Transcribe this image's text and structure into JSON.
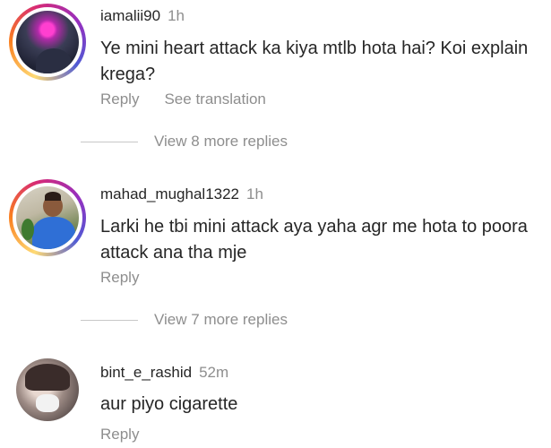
{
  "comments": [
    {
      "username": "iamalii90",
      "time": "1h",
      "text": "Ye mini heart attack ka kiya mtlb hota hai? Koi explain krega?",
      "reply_label": "Reply",
      "translation_label": "See translation",
      "view_replies": "View 8 more replies"
    },
    {
      "username": "mahad_mughal1322",
      "time": "1h",
      "text": "Larki he tbi mini attack aya yaha agr me hota to poora attack ana tha mje",
      "reply_label": "Reply",
      "view_replies": "View 7 more replies"
    },
    {
      "username": "bint_e_rashid",
      "time": "52m",
      "text": "aur piyo cigarette",
      "reply_label": "Reply"
    }
  ],
  "colors": {
    "text": "#262626",
    "muted": "#8e8e8e",
    "story_ring": "#d62976"
  }
}
